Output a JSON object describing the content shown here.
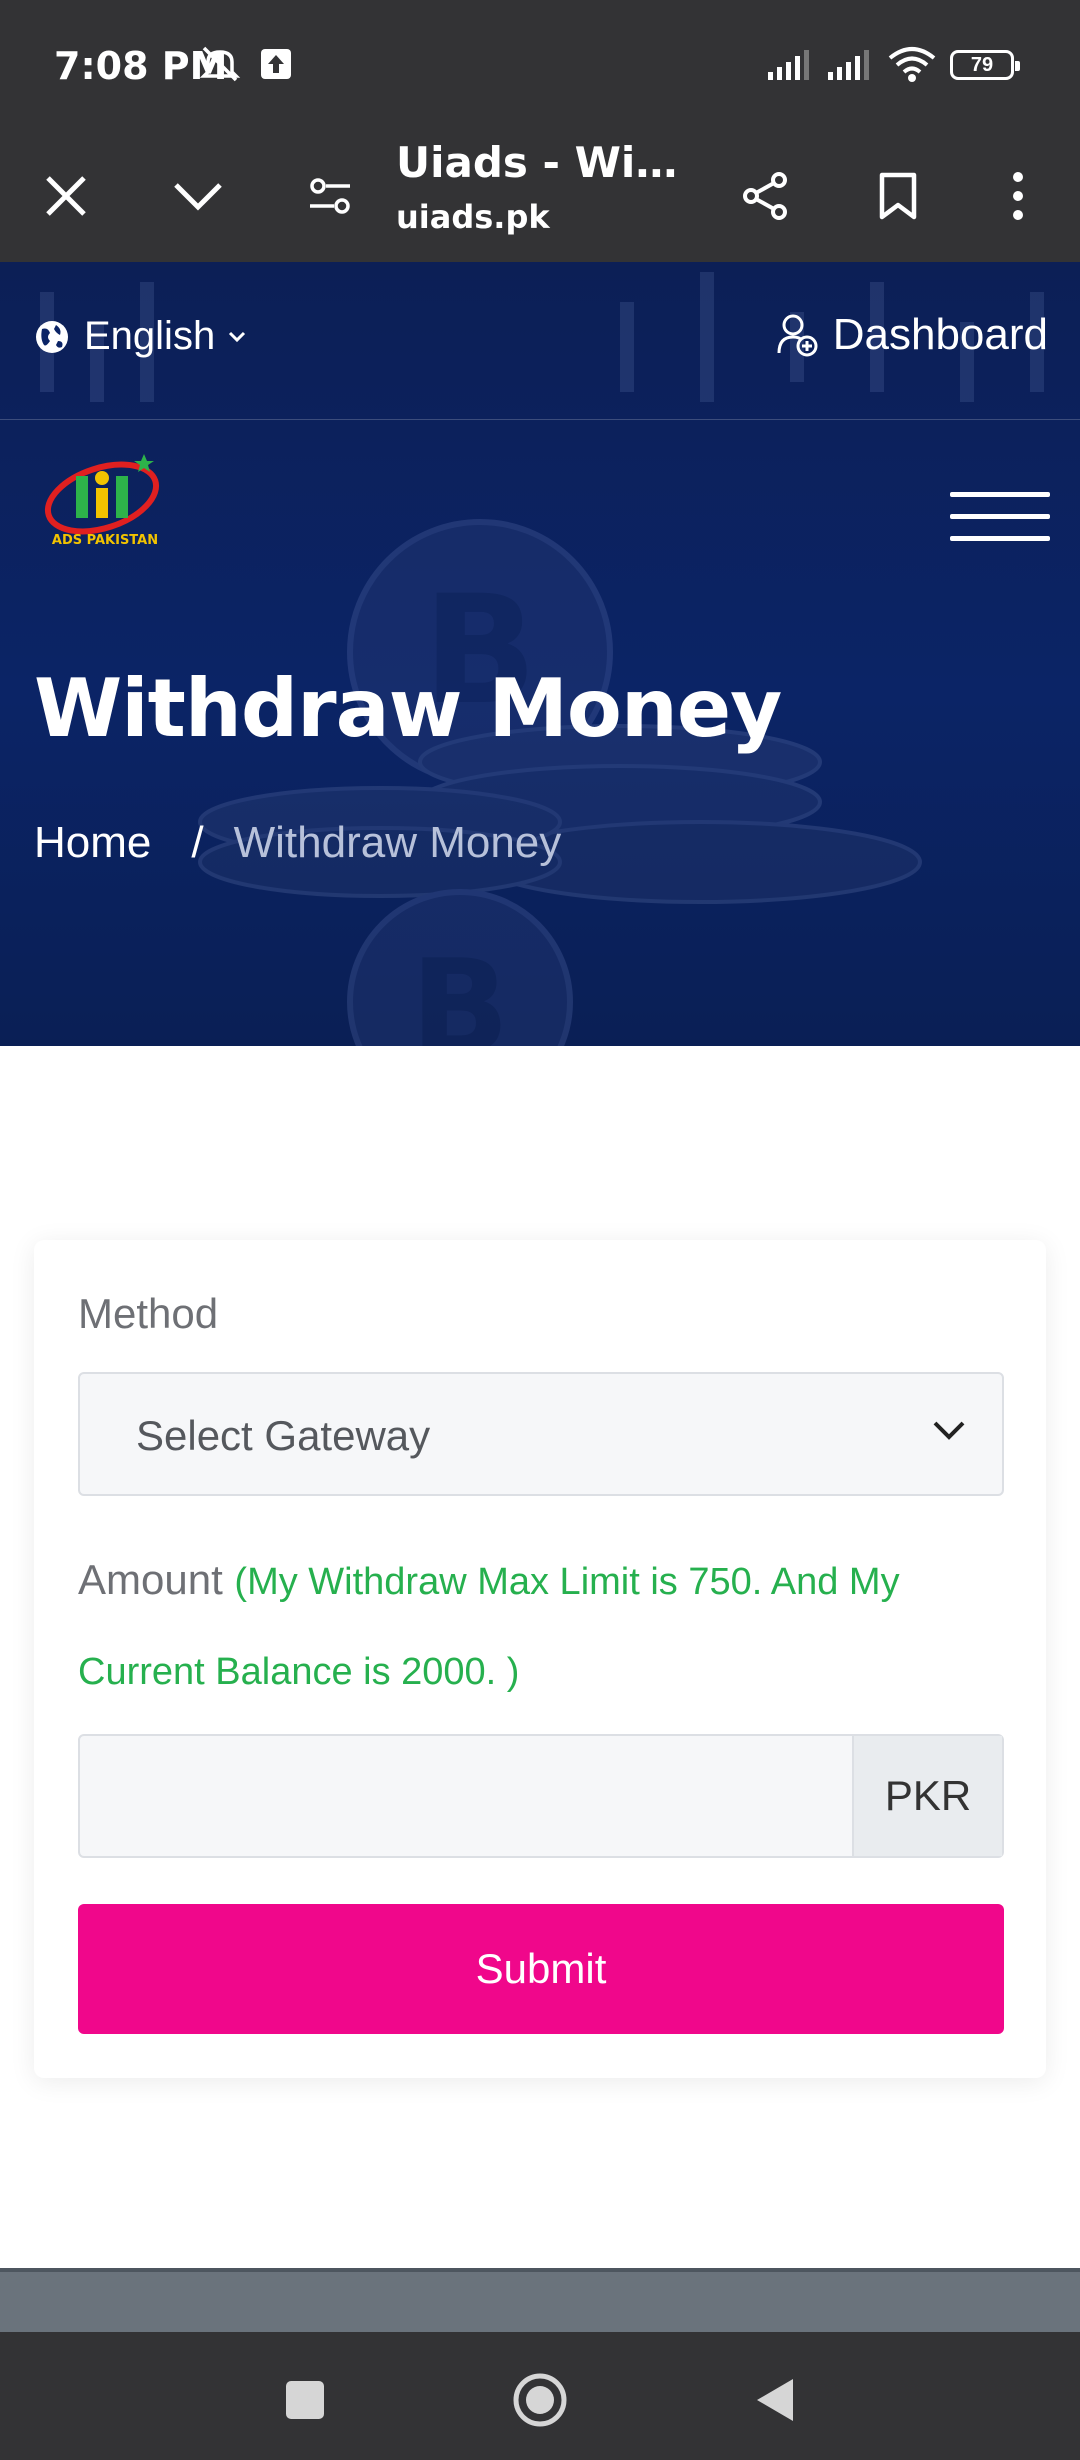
{
  "status_bar": {
    "time": "7:08 PM",
    "battery": "79",
    "icons": [
      "mute-icon",
      "upload-icon",
      "signal-icon",
      "signal-icon",
      "wifi-icon",
      "battery-icon"
    ]
  },
  "browser": {
    "title": "Uiads - With...",
    "url": "uiads.pk",
    "icons": [
      "close-icon",
      "chevron-down-icon",
      "site-settings-icon",
      "share-icon",
      "bookmark-icon",
      "more-icon"
    ]
  },
  "header": {
    "language": "English",
    "dashboard_label": "Dashboard",
    "logo_text": "ADS PAKISTAN"
  },
  "hero": {
    "title": "Withdraw Money",
    "breadcrumb": {
      "home": "Home",
      "separator": "/",
      "current": "Withdraw Money"
    }
  },
  "form": {
    "method_label": "Method",
    "gateway_placeholder": "Select Gateway",
    "amount_label": "Amount",
    "amount_note": "(My Withdraw Max Limit is 750. And My Current Balance is 2000. )",
    "amount_value": "",
    "currency": "PKR",
    "submit_label": "Submit"
  },
  "colors": {
    "accent": "#f0078b",
    "note_green": "#26b04e",
    "hero_bg": "#0b2466"
  }
}
